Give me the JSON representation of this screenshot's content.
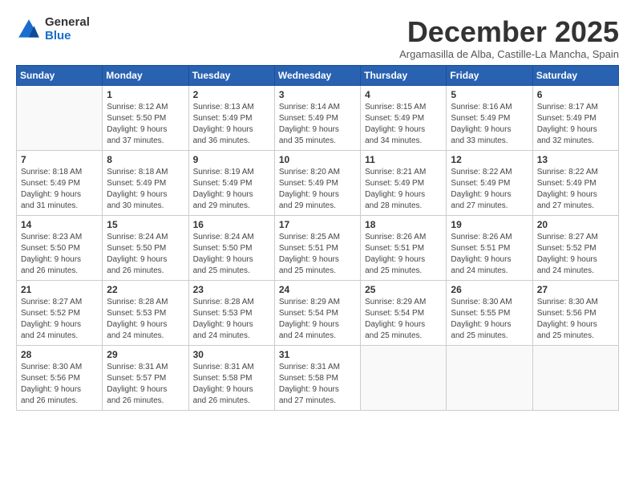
{
  "logo": {
    "general": "General",
    "blue": "Blue"
  },
  "title": "December 2025",
  "subtitle": "Argamasilla de Alba, Castille-La Mancha, Spain",
  "days_of_week": [
    "Sunday",
    "Monday",
    "Tuesday",
    "Wednesday",
    "Thursday",
    "Friday",
    "Saturday"
  ],
  "weeks": [
    [
      {
        "day": "",
        "info": ""
      },
      {
        "day": "1",
        "info": "Sunrise: 8:12 AM\nSunset: 5:50 PM\nDaylight: 9 hours\nand 37 minutes."
      },
      {
        "day": "2",
        "info": "Sunrise: 8:13 AM\nSunset: 5:49 PM\nDaylight: 9 hours\nand 36 minutes."
      },
      {
        "day": "3",
        "info": "Sunrise: 8:14 AM\nSunset: 5:49 PM\nDaylight: 9 hours\nand 35 minutes."
      },
      {
        "day": "4",
        "info": "Sunrise: 8:15 AM\nSunset: 5:49 PM\nDaylight: 9 hours\nand 34 minutes."
      },
      {
        "day": "5",
        "info": "Sunrise: 8:16 AM\nSunset: 5:49 PM\nDaylight: 9 hours\nand 33 minutes."
      },
      {
        "day": "6",
        "info": "Sunrise: 8:17 AM\nSunset: 5:49 PM\nDaylight: 9 hours\nand 32 minutes."
      }
    ],
    [
      {
        "day": "7",
        "info": "Sunrise: 8:18 AM\nSunset: 5:49 PM\nDaylight: 9 hours\nand 31 minutes."
      },
      {
        "day": "8",
        "info": "Sunrise: 8:18 AM\nSunset: 5:49 PM\nDaylight: 9 hours\nand 30 minutes."
      },
      {
        "day": "9",
        "info": "Sunrise: 8:19 AM\nSunset: 5:49 PM\nDaylight: 9 hours\nand 29 minutes."
      },
      {
        "day": "10",
        "info": "Sunrise: 8:20 AM\nSunset: 5:49 PM\nDaylight: 9 hours\nand 29 minutes."
      },
      {
        "day": "11",
        "info": "Sunrise: 8:21 AM\nSunset: 5:49 PM\nDaylight: 9 hours\nand 28 minutes."
      },
      {
        "day": "12",
        "info": "Sunrise: 8:22 AM\nSunset: 5:49 PM\nDaylight: 9 hours\nand 27 minutes."
      },
      {
        "day": "13",
        "info": "Sunrise: 8:22 AM\nSunset: 5:49 PM\nDaylight: 9 hours\nand 27 minutes."
      }
    ],
    [
      {
        "day": "14",
        "info": "Sunrise: 8:23 AM\nSunset: 5:50 PM\nDaylight: 9 hours\nand 26 minutes."
      },
      {
        "day": "15",
        "info": "Sunrise: 8:24 AM\nSunset: 5:50 PM\nDaylight: 9 hours\nand 26 minutes."
      },
      {
        "day": "16",
        "info": "Sunrise: 8:24 AM\nSunset: 5:50 PM\nDaylight: 9 hours\nand 25 minutes."
      },
      {
        "day": "17",
        "info": "Sunrise: 8:25 AM\nSunset: 5:51 PM\nDaylight: 9 hours\nand 25 minutes."
      },
      {
        "day": "18",
        "info": "Sunrise: 8:26 AM\nSunset: 5:51 PM\nDaylight: 9 hours\nand 25 minutes."
      },
      {
        "day": "19",
        "info": "Sunrise: 8:26 AM\nSunset: 5:51 PM\nDaylight: 9 hours\nand 24 minutes."
      },
      {
        "day": "20",
        "info": "Sunrise: 8:27 AM\nSunset: 5:52 PM\nDaylight: 9 hours\nand 24 minutes."
      }
    ],
    [
      {
        "day": "21",
        "info": "Sunrise: 8:27 AM\nSunset: 5:52 PM\nDaylight: 9 hours\nand 24 minutes."
      },
      {
        "day": "22",
        "info": "Sunrise: 8:28 AM\nSunset: 5:53 PM\nDaylight: 9 hours\nand 24 minutes."
      },
      {
        "day": "23",
        "info": "Sunrise: 8:28 AM\nSunset: 5:53 PM\nDaylight: 9 hours\nand 24 minutes."
      },
      {
        "day": "24",
        "info": "Sunrise: 8:29 AM\nSunset: 5:54 PM\nDaylight: 9 hours\nand 24 minutes."
      },
      {
        "day": "25",
        "info": "Sunrise: 8:29 AM\nSunset: 5:54 PM\nDaylight: 9 hours\nand 25 minutes."
      },
      {
        "day": "26",
        "info": "Sunrise: 8:30 AM\nSunset: 5:55 PM\nDaylight: 9 hours\nand 25 minutes."
      },
      {
        "day": "27",
        "info": "Sunrise: 8:30 AM\nSunset: 5:56 PM\nDaylight: 9 hours\nand 25 minutes."
      }
    ],
    [
      {
        "day": "28",
        "info": "Sunrise: 8:30 AM\nSunset: 5:56 PM\nDaylight: 9 hours\nand 26 minutes."
      },
      {
        "day": "29",
        "info": "Sunrise: 8:31 AM\nSunset: 5:57 PM\nDaylight: 9 hours\nand 26 minutes."
      },
      {
        "day": "30",
        "info": "Sunrise: 8:31 AM\nSunset: 5:58 PM\nDaylight: 9 hours\nand 26 minutes."
      },
      {
        "day": "31",
        "info": "Sunrise: 8:31 AM\nSunset: 5:58 PM\nDaylight: 9 hours\nand 27 minutes."
      },
      {
        "day": "",
        "info": ""
      },
      {
        "day": "",
        "info": ""
      },
      {
        "day": "",
        "info": ""
      }
    ]
  ]
}
